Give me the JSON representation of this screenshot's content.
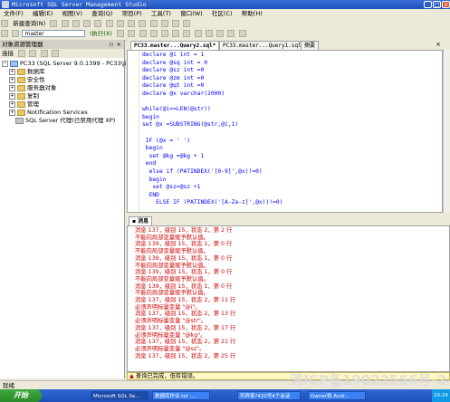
{
  "window": {
    "title": "Microsoft SQL Server Management Studio"
  },
  "menu": [
    "文件(F)",
    "编辑(E)",
    "视图(V)",
    "查询(Q)",
    "项目(P)",
    "工具(T)",
    "窗口(W)",
    "社区(C)",
    "帮助(H)"
  ],
  "toolbar1": {
    "new_query_label": "新建查询(N)"
  },
  "toolbar2": {
    "database": "master",
    "execute_label": "执行(X)"
  },
  "object_explorer": {
    "title": "对象资源管理器",
    "connect_label": "连接",
    "server": "PC33 (SQL Server 9.0.1399 - PC33\\jiep)",
    "nodes": [
      "数据库",
      "安全性",
      "服务器对象",
      "复制",
      "管理",
      "Notification Services",
      "SQL Server 代理(已禁用代理 XP)"
    ]
  },
  "editor": {
    "tabs": [
      "PC33.master...Query2.sql*",
      "PC33.master...Query1.sql*",
      "摘要"
    ],
    "lines": [
      "declare @i int = 1",
      "declare @sq int = 0",
      "declare @sz int =0",
      "declare @zm int =0",
      "declare @qt int =0",
      "declare @x varchar(2000)",
      "",
      "while(@i<=LEN(@str))",
      "begin",
      "set @x =SUBSTRING(@str,@i,1)",
      "",
      " IF (@x = ' ')",
      " begin",
      "  set @kg =@kg + 1",
      " end",
      "  else if (PATINDEX('[0-9]',@x)!=0)",
      "  begin",
      "   set @sz=@sz +1",
      "  END",
      "    ELSE IF (PATINDEX('[A-Za-z]',@x))!=0)"
    ]
  },
  "results": {
    "tab": "消息",
    "messages": [
      "消息 137，级别 15，状态 2，第 2 行",
      "不能向局部变量赋予默认值。",
      "消息 139，级别 15，状态 1，第 0 行",
      "不能向局部变量赋予默认值。",
      "消息 139，级别 15，状态 1，第 0 行",
      "不能向局部变量赋予默认值。",
      "消息 139，级别 15，状态 1，第 0 行",
      "不能向局部变量赋予默认值。",
      "消息 139，级别 15，状态 1，第 0 行",
      "不能向局部变量赋予默认值。",
      "消息 137，级别 15，状态 2，第 11 行",
      "必须声明标量变量 \"@i\"。",
      "消息 137，级别 15，状态 2，第 13 行",
      "必须声明标量变量 \"@str\"。",
      "消息 137，级别 15，状态 2，第 17 行",
      "必须声明标量变量 \"@kg\"。",
      "消息 137，级别 15，状态 2，第 21 行",
      "必须声明标量变量 \"@sz\"。",
      "消息 137，级别 15，状态 2，第 25 行"
    ]
  },
  "query_status": "查询已完成，但有错误。",
  "status_bar": "就绪",
  "taskbar": {
    "start_label": "开始",
    "tasks": [
      "Microsoft SQL Se...",
      "数据库作业.txt -...",
      "列宾客?420号4个会话",
      "Owner和 Andr..."
    ],
    "clock": "10:24"
  },
  "watermark": "漳ICP备19022556号-2"
}
